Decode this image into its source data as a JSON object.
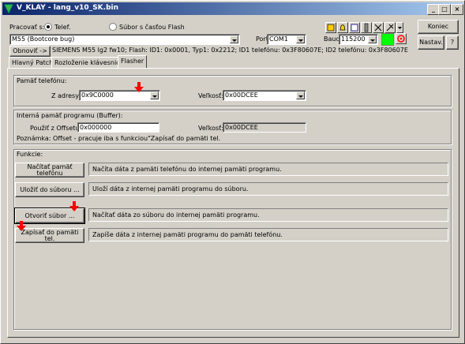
{
  "window": {
    "title": "V_KLAY - lang_v10_SK.bin"
  },
  "top": {
    "work_with_label": "Pracovať s:",
    "radio_phone": "Telef.",
    "radio_file": "Súbor s časťou Flash",
    "phone_model": "M55 (Bootcore bug)",
    "port_label": "Port",
    "port_value": "COM1",
    "baud_label": "Baud",
    "baud_value": "115200",
    "refresh_button": "Obnoviť ->",
    "phone_info": "SIEMENS M55 lg2 fw10; Flash: ID1: 0x0001, Typ1: 0x2212; ID1 telefónu: 0x3F80607E; ID2 telefónu: 0x3F80607E",
    "end_button": "Koniec",
    "settings_button": "Nastav.",
    "help_button": "?",
    "status_color": "#00ff00"
  },
  "tabs": [
    {
      "label": "Hlavný Patch"
    },
    {
      "label": "Rozloženie klávesnice"
    },
    {
      "label": "Flasher"
    }
  ],
  "phone_memory": {
    "title": "Pamäť telefónu:",
    "address_label": "Z adresy:",
    "address_value": "0x9C0000",
    "size_label": "Veľkosť:",
    "size_value": "0x00DCEE"
  },
  "buffer": {
    "title": "Interná pamäť programu (Buffer):",
    "offset_label": "Použiť z Offsetu:",
    "offset_value": "0x000000",
    "size_label": "Veľkosť:",
    "size_value": "0x00DCEE",
    "note": "Poznámka: Offset - pracuje iba s funkciou\"Zapísať do pamäti tel."
  },
  "functions": {
    "title": "Funkcie:",
    "items": [
      {
        "button": "Načítať pamäť telefónu",
        "desc": "Načíta dáta z pamäti telefónu do internej pamäti programu."
      },
      {
        "button": "Uložiť do súboru ...",
        "desc": "Uloží dáta z internej pamäti programu do súboru."
      },
      {
        "button": "Otvoriť súbor ...",
        "desc": "Načítať dáta zo súboru do internej pamäti programu."
      },
      {
        "button": "Zapísať do pamäti tel.",
        "desc": "Zapíše dáta z internej pamäti programu do pamäti telefónu."
      }
    ]
  },
  "colors": {
    "annotation_arrow": "#ff0000",
    "title_start": "#0a246a",
    "title_end": "#a6caf0"
  }
}
